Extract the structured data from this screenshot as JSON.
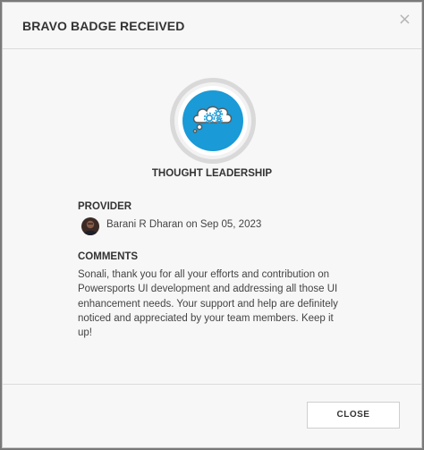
{
  "dialog": {
    "title": "BRAVO BADGE RECEIVED",
    "close_icon": "×",
    "close_button_label": "CLOSE"
  },
  "badge": {
    "name": "THOUGHT LEADERSHIP",
    "icon": "thought-bubble-gears-icon",
    "color": "#1a9ad6"
  },
  "provider": {
    "label": "PROVIDER",
    "text": "Barani R Dharan on Sep 05, 2023",
    "avatar": "provider-avatar"
  },
  "comments": {
    "label": "COMMENTS",
    "text": "Sonali, thank you for all your efforts and contribution on Powersports UI development and addressing all those UI enhancement needs. Your support and help are definitely noticed and appreciated by your team members. Keep it up!"
  }
}
